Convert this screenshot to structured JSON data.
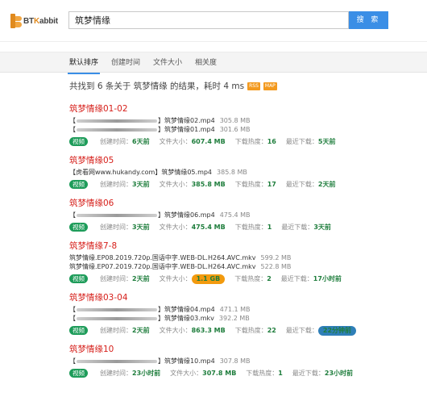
{
  "header": {
    "logo_text_prefix": "BT",
    "logo_text_k": "K",
    "logo_text_suffix": "abbit",
    "search_value": "筑梦情缘",
    "search_button": "搜 索"
  },
  "tabs": [
    {
      "label": "默认排序",
      "active": true
    },
    {
      "label": "创建时间",
      "active": false
    },
    {
      "label": "文件大小",
      "active": false
    },
    {
      "label": "相关度",
      "active": false
    }
  ],
  "summary": {
    "text": "共找到 6 条关于 筑梦情缘 的结果，耗时 4 ms",
    "rss_label": "RSS",
    "map_label": "MAP"
  },
  "labels": {
    "badge": "视频",
    "created": "创建时间：",
    "size": "文件大小：",
    "heat": "下载热度：",
    "recent": "最近下载："
  },
  "results": [
    {
      "title": "筑梦情缘01-02",
      "files": [
        {
          "prefix": "【",
          "mid": "】",
          "name": "筑梦情缘02.mp4",
          "size": "305.8 MB",
          "blur": 100
        },
        {
          "prefix": "【",
          "mid": "】",
          "name": "筑梦情缘01.mp4",
          "size": "301.6 MB",
          "blur": 100
        }
      ],
      "created": "6天前",
      "filesize": "607.4 MB",
      "heat": "16",
      "recent": "5天前",
      "filesize_style": "",
      "recent_style": ""
    },
    {
      "title": "筑梦情缘05",
      "files": [
        {
          "prefix": "【虎看网www.hukandy.com】",
          "mid": "",
          "name": "筑梦情缘05.mp4",
          "size": "385.8 MB",
          "blur": 0
        }
      ],
      "created": "3天前",
      "filesize": "385.8 MB",
      "heat": "17",
      "recent": "2天前",
      "filesize_style": "",
      "recent_style": ""
    },
    {
      "title": "筑梦情缘06",
      "files": [
        {
          "prefix": "【",
          "mid": "】",
          "name": "筑梦情缘06.mp4",
          "size": "475.4 MB",
          "blur": 100
        }
      ],
      "created": "3天前",
      "filesize": "475.4 MB",
      "heat": "1",
      "recent": "3天前",
      "filesize_style": "",
      "recent_style": ""
    },
    {
      "title": "筑梦情缘7-8",
      "files": [
        {
          "prefix": "",
          "mid": "",
          "name": "筑梦情缘.EP08.2019.720p.国语中字.WEB-DL.H264.AVC.mkv",
          "size": "599.2 MB",
          "blur": 0
        },
        {
          "prefix": "",
          "mid": "",
          "name": "筑梦情缘.EP07.2019.720p.国语中字.WEB-DL.H264.AVC.mkv",
          "size": "522.8 MB",
          "blur": 0
        }
      ],
      "created": "2天前",
      "filesize": "1.1 GB",
      "heat": "2",
      "recent": "17小时前",
      "filesize_style": "orange",
      "recent_style": ""
    },
    {
      "title": "筑梦情缘03-04",
      "files": [
        {
          "prefix": "【",
          "mid": "】",
          "name": "筑梦情缘04.mp4",
          "size": "471.1 MB",
          "blur": 100
        },
        {
          "prefix": "【",
          "mid": "】",
          "name": "筑梦情缘03.mkv",
          "size": "392.2 MB",
          "blur": 100
        }
      ],
      "created": "2天前",
      "filesize": "863.3 MB",
      "heat": "22",
      "recent": "22分钟前",
      "filesize_style": "",
      "recent_style": "blue"
    },
    {
      "title": "筑梦情缘10",
      "files": [
        {
          "prefix": "【",
          "mid": "】",
          "name": "筑梦情缘10.mp4",
          "size": "307.8 MB",
          "blur": 100
        }
      ],
      "created": "23小时前",
      "filesize": "307.8 MB",
      "heat": "1",
      "recent": "23小时前",
      "filesize_style": "",
      "recent_style": ""
    }
  ]
}
